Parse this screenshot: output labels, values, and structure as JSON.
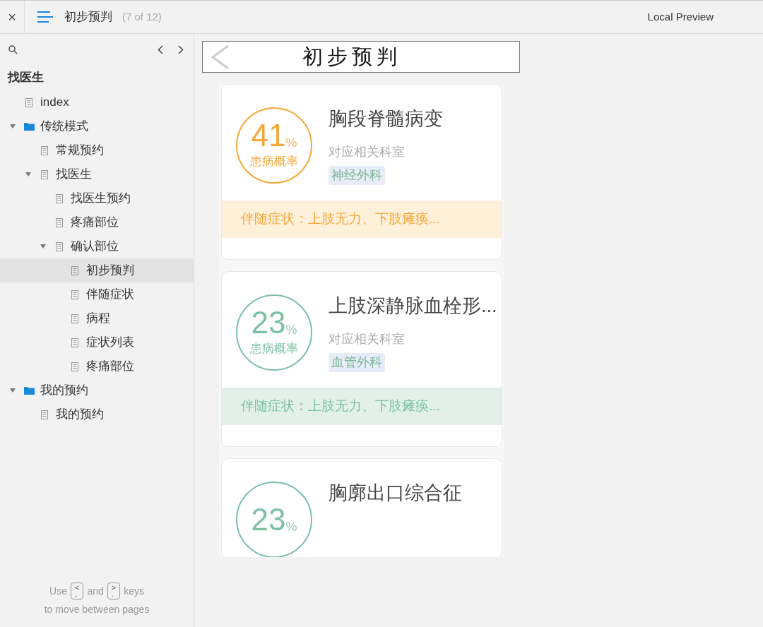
{
  "topbar": {
    "close": "×",
    "title": "初步预判",
    "counter": "(7 of 12)",
    "preview": "Local Preview"
  },
  "sidebar": {
    "heading": "找医生",
    "items": [
      {
        "kind": "page",
        "label": "index",
        "selected": false
      },
      {
        "kind": "folder",
        "label": "传统模式",
        "expanded": true,
        "selected": false,
        "children": [
          {
            "kind": "page",
            "label": "常规预约",
            "selected": false
          },
          {
            "kind": "page",
            "label": "找医生",
            "expanded": true,
            "selected": false,
            "children": [
              {
                "kind": "page",
                "label": "找医生预约",
                "selected": false
              },
              {
                "kind": "page",
                "label": "疼痛部位",
                "selected": false
              },
              {
                "kind": "page",
                "label": "确认部位",
                "expanded": true,
                "selected": false,
                "children": [
                  {
                    "kind": "page",
                    "label": "初步预判",
                    "selected": true
                  },
                  {
                    "kind": "page",
                    "label": "伴随症状",
                    "selected": false
                  },
                  {
                    "kind": "page",
                    "label": "病程",
                    "selected": false
                  },
                  {
                    "kind": "page",
                    "label": "症状列表",
                    "selected": false
                  },
                  {
                    "kind": "page",
                    "label": "疼痛部位",
                    "selected": false
                  }
                ]
              }
            ]
          }
        ]
      },
      {
        "kind": "folder",
        "label": "我的预约",
        "expanded": true,
        "selected": false,
        "children": [
          {
            "kind": "page",
            "label": "我的预约",
            "selected": false
          }
        ]
      }
    ],
    "hint": {
      "use": "Use",
      "key_1": {
        "top": "<",
        "bottom": ","
      },
      "and": "and",
      "key_2": {
        "top": ">",
        "bottom": "."
      },
      "keys": "keys",
      "line_2": "to move between pages"
    }
  },
  "page": {
    "header": {
      "title": "初步预判"
    },
    "cards": [
      {
        "color": "#f5a83a",
        "percent": "41",
        "unit": "%",
        "rate_label": "患病概率",
        "title": "胸段脊髓病变",
        "dept_label": "对应相关科室",
        "tag": "神经外科",
        "symptoms": "伴随症状：上肢无力、下肢瘫痪..."
      },
      {
        "color": "#7cc1a2",
        "percent": "23",
        "unit": "%",
        "rate_label": "患病概率",
        "title": "上肢深静脉血栓形...",
        "dept_label": "对应相关科室",
        "tag": "血管外科",
        "symptoms": "伴随症状：上肢无力、下肢瘫痪..."
      },
      {
        "color": "#7cc1a2",
        "percent": "23",
        "unit": "%",
        "title": "胸廓出口综合征"
      }
    ]
  }
}
